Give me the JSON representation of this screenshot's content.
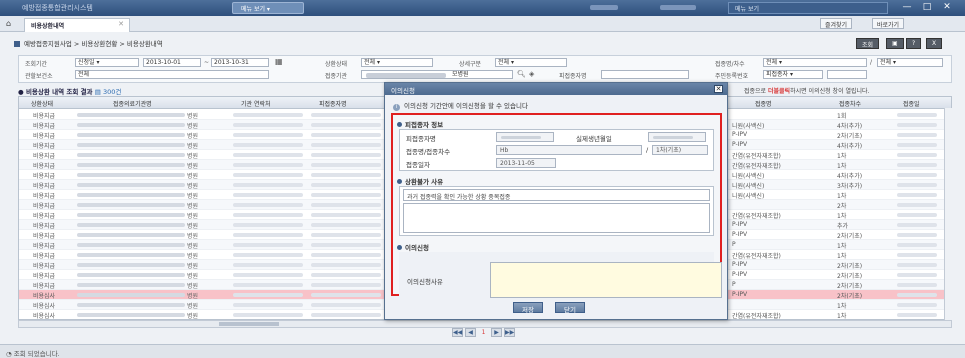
{
  "window": {
    "app_title": "예방접종통합관리시스템",
    "menu_button": "메뉴 보기",
    "top_right_button": "메뉴 보기",
    "min": "—",
    "max": "□",
    "close": "✕"
  },
  "tabs": {
    "active": "비용상환내역",
    "right_buttons": [
      "즐겨찾기",
      "바로가기"
    ]
  },
  "page": {
    "breadcrumb": "예방접종지원사업 > 비용상환현황 > 비용상환내역",
    "buttons": [
      "조회",
      "?",
      "X"
    ]
  },
  "search": {
    "period_label": "조회기간",
    "period_type": "신청일",
    "date_from": "2013-10-01",
    "date_to": "2013-10-31",
    "repay_status_label": "상환상태",
    "repay_status_value": "전체",
    "detail_label": "상세구분",
    "detail_value": "전체",
    "vaccine_label": "접종명/차수",
    "vaccine_value": "전체",
    "vaccine_value2": "전체",
    "health_center_label": "관할보건소",
    "health_center_value": "전체",
    "institution_label": "접종기관",
    "institution_suffix": "모병원",
    "recipient_label": "피접종자명",
    "rrn_label": "주민등록번호",
    "rrn_select": "피접종자"
  },
  "results": {
    "title": "비용상환 내역 조회 결과",
    "count": "300건",
    "note_pre": "접종으로 ",
    "note_red": "더블클릭",
    "note_post": "하시면 이의신청 창이 열립니다.",
    "columns": [
      "상환상태",
      "접종의료기관명",
      "기관 연락처",
      "피접종자명",
      "접종명",
      "접종차수",
      "접종일"
    ],
    "rows": [
      {
        "status": "비용지급",
        "inst": "병원",
        "vaccine": "",
        "dose": "1회"
      },
      {
        "status": "비용지급",
        "inst": "병원",
        "vaccine": "니원(사백신)",
        "dose": "4차(추가)"
      },
      {
        "status": "비용지급",
        "inst": "병원",
        "vaccine": "P-IPV",
        "dose": "2차(기초)"
      },
      {
        "status": "비용지급",
        "inst": "병원",
        "vaccine": "P-IPV",
        "dose": "4차(추가)"
      },
      {
        "status": "비용지급",
        "inst": "병원",
        "vaccine": "간염(유전자재조합)",
        "dose": "1차"
      },
      {
        "status": "비용지급",
        "inst": "병원",
        "vaccine": "간염(유전자재조합)",
        "dose": "1차"
      },
      {
        "status": "비용지급",
        "inst": "병원",
        "vaccine": "니원(사백신)",
        "dose": "4차(추가)"
      },
      {
        "status": "비용지급",
        "inst": "병원",
        "vaccine": "니원(사백신)",
        "dose": "3차(추가)"
      },
      {
        "status": "비용지급",
        "inst": "병원",
        "vaccine": "니원(사백신)",
        "dose": "1차"
      },
      {
        "status": "비용지급",
        "inst": "병원",
        "vaccine": "",
        "dose": "2차"
      },
      {
        "status": "비용지급",
        "inst": "병원",
        "vaccine": "간염(유전자재조합)",
        "dose": "1차"
      },
      {
        "status": "비용지급",
        "inst": "병원",
        "vaccine": "P-IPV",
        "dose": "추가"
      },
      {
        "status": "비용지급",
        "inst": "병원",
        "vaccine": "P-IPV",
        "dose": "2차(기초)"
      },
      {
        "status": "비용지급",
        "inst": "병원",
        "vaccine": "P",
        "dose": "1차"
      },
      {
        "status": "비용지급",
        "inst": "병원",
        "vaccine": "간염(유전자재조합)",
        "dose": "1차"
      },
      {
        "status": "비용지급",
        "inst": "병원",
        "vaccine": "P-IPV",
        "dose": "2차(기초)"
      },
      {
        "status": "비용지급",
        "inst": "병원",
        "vaccine": "P-IPV",
        "dose": "2차(기초)"
      },
      {
        "status": "비용지급",
        "inst": "병원",
        "vaccine": "P",
        "dose": "2차(기초)"
      },
      {
        "status": "비용심사",
        "inst": "병원",
        "vaccine": "P-IPV",
        "dose": "2차(기초)"
      },
      {
        "status": "비용심사",
        "inst": "병원",
        "vaccine": "",
        "dose": "1차"
      },
      {
        "status": "비용심사",
        "inst": "병원",
        "vaccine": "간염(유전자재조합)",
        "dose": "1차"
      },
      {
        "status": "비용심사",
        "inst": "병원",
        "vaccine": "간염(유전자재조합)",
        "dose": "1차"
      }
    ],
    "highlighted_row": 18
  },
  "pager": {
    "first": "◀◀",
    "prev": "◀",
    "page": "1",
    "next": "▶",
    "last": "▶▶"
  },
  "status_bar": "조회 되었습니다.",
  "modal": {
    "title": "이의신청",
    "close": "✕",
    "notice": "이의신청 기간안에 이의신청을 할 수 있습니다",
    "section1": "피접종자 정보",
    "recipient_label": "피접종자명",
    "birth_label": "실제생년월일",
    "vaccine_label": "접종명/접종차수",
    "vaccine_value": "Hb",
    "dose_value": "1차(기초)",
    "date_label": "접종일자",
    "date_value": "2013-11-05",
    "section2": "상환불가 사유",
    "reject_reason": "과거 접종력을 확인 가능한 상황 중복접종",
    "section3": "이의신청",
    "appeal_label": "이의신청사유",
    "save_button": "저장",
    "close_button": "닫기"
  }
}
